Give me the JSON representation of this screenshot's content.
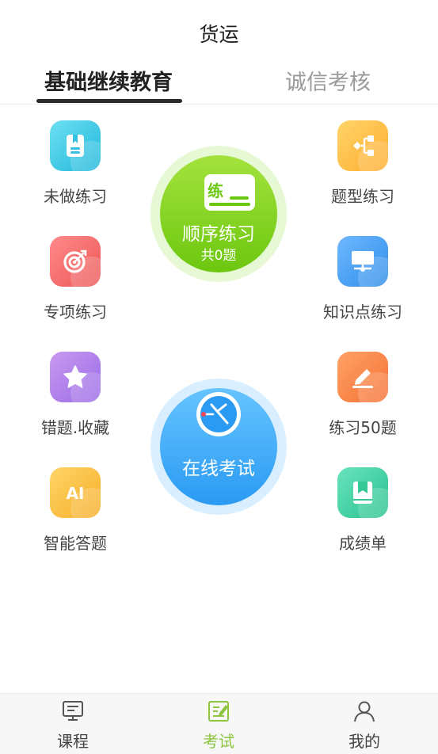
{
  "header": {
    "title": "货运"
  },
  "tabs": [
    {
      "label": "基础继续教育",
      "active": true
    },
    {
      "label": "诚信考核",
      "active": false
    }
  ],
  "left_items": [
    {
      "label": "未做练习",
      "icon": "notebook-icon",
      "color": "#1fb7db"
    },
    {
      "label": "专项练习",
      "icon": "target-icon",
      "color": "#ec5757"
    },
    {
      "label": "错题.收藏",
      "icon": "star-icon",
      "color": "#9a6ae6"
    },
    {
      "label": "智能答题",
      "icon": "ai-icon",
      "color": "#f6ae2a"
    }
  ],
  "right_items": [
    {
      "label": "题型练习",
      "icon": "hierarchy-icon",
      "color": "#ffad2e"
    },
    {
      "label": "知识点练习",
      "icon": "presentation-icon",
      "color": "#2f8ee9"
    },
    {
      "label": "练习50题",
      "icon": "pencil-icon",
      "color": "#f57134"
    },
    {
      "label": "成绩单",
      "icon": "bookmark-book-icon",
      "color": "#29c290"
    }
  ],
  "practice": {
    "badge": "练",
    "title": "顺序练习",
    "count": "共0题",
    "color": "#6cc70f"
  },
  "exam": {
    "title": "在线考试",
    "color": "#2a9af3"
  },
  "bottom_nav": [
    {
      "label": "课程",
      "icon": "monitor-icon",
      "active": false
    },
    {
      "label": "考试",
      "icon": "exam-paper-icon",
      "active": true
    },
    {
      "label": "我的",
      "icon": "user-icon",
      "active": false
    }
  ],
  "colors": {
    "accent": "#8cc63e",
    "tab_active": "#222222",
    "tab_inactive": "#9a9a9a"
  }
}
